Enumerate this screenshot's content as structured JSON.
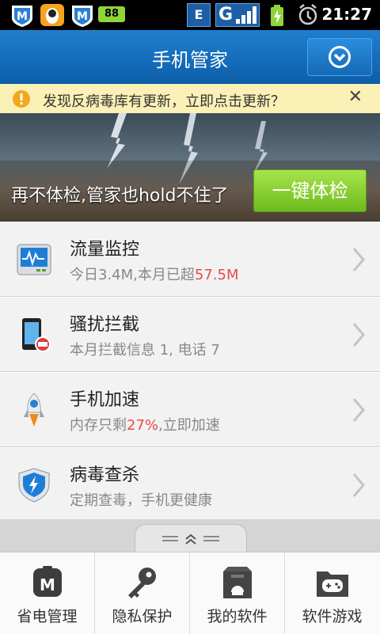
{
  "statusbar": {
    "time": "21:27",
    "battery_level": "88",
    "network": "E",
    "signal": "G",
    "icons": [
      "tencent-manager-icon",
      "qq-icon",
      "tencent-manager-icon",
      "battery-88-icon",
      "edge-network-icon",
      "signal-icon",
      "charging-icon",
      "alarm-icon"
    ]
  },
  "header": {
    "title": "手机管家",
    "menu_icon": "dropdown-circle-icon"
  },
  "notice": {
    "text": "发现反病毒库有更新，立即点击更新？",
    "close": "✕"
  },
  "banner": {
    "text": "再不体检,管家也hold不住了",
    "button": "一键体检"
  },
  "list": [
    {
      "title": "流量监控",
      "sub_pre": "今日3.4M,本月已超",
      "sub_hl": "57.5M",
      "sub_post": "",
      "icon": "traffic-monitor-icon"
    },
    {
      "title": "骚扰拦截",
      "sub_pre": "本月拦截信息 1, 电话 7",
      "sub_hl": "",
      "sub_post": "",
      "icon": "phone-block-icon"
    },
    {
      "title": "手机加速",
      "sub_pre": "内存只剩",
      "sub_hl": "27%",
      "sub_post": ",立即加速",
      "icon": "rocket-icon"
    },
    {
      "title": "病毒查杀",
      "sub_pre": "定期查毒，手机更健康",
      "sub_hl": "",
      "sub_post": "",
      "icon": "shield-bolt-icon"
    }
  ],
  "dock": [
    {
      "label": "省电管理",
      "icon": "battery-save-icon"
    },
    {
      "label": "隐私保护",
      "icon": "key-icon"
    },
    {
      "label": "我的软件",
      "icon": "software-box-icon"
    },
    {
      "label": "软件游戏",
      "icon": "gamepad-folder-icon"
    }
  ],
  "colors": {
    "accent": "#1469b5",
    "highlight": "#e94b4b",
    "check_button": "#7ac62a"
  }
}
